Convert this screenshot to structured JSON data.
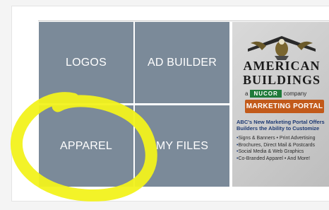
{
  "tiles": [
    {
      "label": "LOGOS"
    },
    {
      "label": "AD BUILDER"
    },
    {
      "label": "APPAREL"
    },
    {
      "label": "MY FILES"
    }
  ],
  "promo": {
    "brand_line1": "AMERICAN",
    "brand_line2": "BUILDINGS",
    "nucor_prefix": "a",
    "nucor_badge": "NUCOR",
    "nucor_suffix": "company",
    "portal_label": "MARKETING PORTAL",
    "headline": "ABC's New Marketing Portal Offers Builders the Ability to Customize",
    "bullets": [
      "Signs & Banners • Print Advertising",
      "Brochures, Direct Mail & Postcards",
      "Social Media & Web Graphics",
      "Co-Branded Apparel • And More!"
    ]
  },
  "colors": {
    "tile_bg": "#7b8a99",
    "highlight": "#f2f21c",
    "portal_bg": "#c25a1a",
    "nucor_green": "#1f7a3a"
  }
}
